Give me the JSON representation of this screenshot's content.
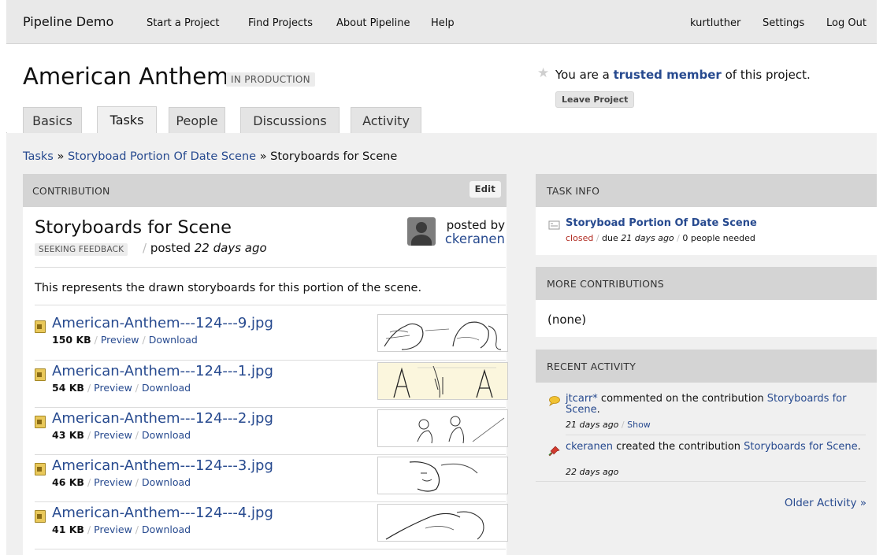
{
  "nav": {
    "brand": "Pipeline Demo",
    "left_links": [
      "Start a Project",
      "Find Projects",
      "About Pipeline",
      "Help"
    ],
    "right_links": [
      "kurtluther",
      "Settings",
      "Log Out"
    ]
  },
  "project": {
    "title": "American Anthem",
    "status": "IN PRODUCTION",
    "membership_prefix": "You are a ",
    "membership_role": "trusted member",
    "membership_suffix": " of this project.",
    "leave_label": "Leave Project"
  },
  "tabs": [
    "Basics",
    "Tasks",
    "People",
    "Discussions",
    "Activity"
  ],
  "active_tab": "Tasks",
  "breadcrumb": {
    "root": "Tasks",
    "parent": "Storyboad Portion Of Date Scene",
    "current": "Storyboards for Scene",
    "separator": "»"
  },
  "contribution": {
    "header": "CONTRIBUTION",
    "edit_label": "Edit",
    "title": "Storyboards for Scene",
    "status": "SEEKING FEEDBACK",
    "posted_prefix": "posted ",
    "posted_ago": "22 days ago",
    "posted_by_label": "posted by",
    "author": "ckeranen",
    "description": "This represents the drawn storyboards for this portion of the scene.",
    "files": [
      {
        "name": "American-Anthem---124---9.jpg",
        "size": "150 KB",
        "preview": "Preview",
        "download": "Download"
      },
      {
        "name": "American-Anthem---124---1.jpg",
        "size": "54 KB",
        "preview": "Preview",
        "download": "Download"
      },
      {
        "name": "American-Anthem---124---2.jpg",
        "size": "43 KB",
        "preview": "Preview",
        "download": "Download"
      },
      {
        "name": "American-Anthem---124---3.jpg",
        "size": "46 KB",
        "preview": "Preview",
        "download": "Download"
      },
      {
        "name": "American-Anthem---124---4.jpg",
        "size": "41 KB",
        "preview": "Preview",
        "download": "Download"
      }
    ]
  },
  "task_info": {
    "header": "TASK INFO",
    "task_name": "Storyboad Portion Of Date Scene",
    "state": "closed",
    "due_prefix": "due ",
    "due": "21 days ago",
    "needed": "0 people needed"
  },
  "more_contributions": {
    "header": "MORE CONTRIBUTIONS",
    "empty_text": "(none)"
  },
  "recent_activity": {
    "header": "RECENT ACTIVITY",
    "items": [
      {
        "user": "jtcarr*",
        "action": " commented on the contribution ",
        "target": "Storyboards for Scene",
        "end": ".",
        "time": "21 days ago",
        "show": "Show",
        "icon": "comment-icon"
      },
      {
        "user": "ckeranen",
        "action": " created the contribution ",
        "target": "Storyboards for Scene",
        "end": ".",
        "time": "22 days ago",
        "icon": "pin-icon"
      }
    ],
    "older_label": "Older Activity »"
  },
  "colors": {
    "link": "#274a8f",
    "closed": "#b02a20",
    "panel_header": "#d4d4d4",
    "page_bg": "#f0f0f0"
  }
}
